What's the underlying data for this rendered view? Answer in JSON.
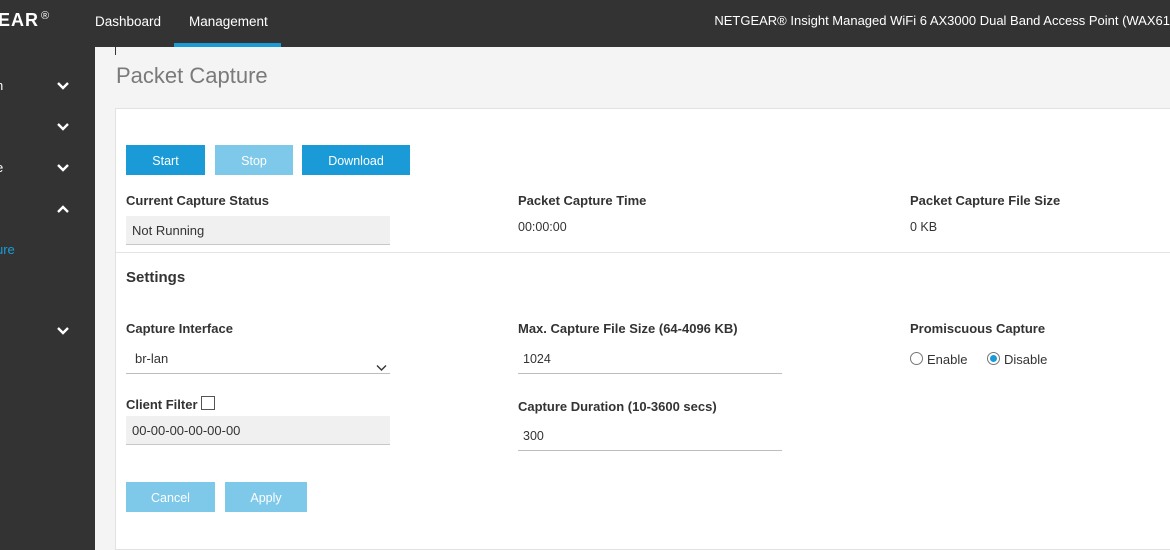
{
  "header": {
    "logo": "EAR",
    "logo_mark": "®",
    "tabs": [
      "Dashboard",
      "Management"
    ],
    "active_tab": "Management",
    "device_title": "NETGEAR® Insight Managed WiFi 6 AX3000 Dual Band Access Point (WAX61"
  },
  "sidebar": {
    "items": [
      {
        "label": "n",
        "icon": "chevron-down-icon"
      },
      {
        "label": "",
        "icon": "chevron-down-icon"
      },
      {
        "label": "e",
        "icon": "chevron-down-icon"
      },
      {
        "label": "",
        "icon": "chevron-up-icon"
      },
      {
        "label": "ure",
        "icon": ""
      },
      {
        "label": "",
        "icon": "chevron-down-icon"
      }
    ]
  },
  "page": {
    "title": "Packet Capture",
    "buttons": {
      "start": "Start",
      "stop": "Stop",
      "download": "Download"
    },
    "status": {
      "current_label": "Current Capture Status",
      "current_value": "Not Running",
      "time_label": "Packet Capture Time",
      "time_value": "00:00:00",
      "size_label": "Packet Capture File Size",
      "size_value": "0 KB"
    },
    "settings": {
      "title": "Settings",
      "interface_label": "Capture Interface",
      "interface_value": "br-lan",
      "max_size_label": "Max. Capture File Size (64-4096 KB)",
      "max_size_value": "1024",
      "promiscuous_label": "Promiscuous Capture",
      "promiscuous_options": [
        "Enable",
        "Disable"
      ],
      "promiscuous_selected": "Disable",
      "client_filter_label": "Client Filter",
      "client_filter_checked": false,
      "client_filter_value": "00-00-00-00-00-00",
      "duration_label": "Capture Duration (10-3600 secs)",
      "duration_value": "300"
    },
    "footer_buttons": {
      "cancel": "Cancel",
      "apply": "Apply"
    }
  },
  "colors": {
    "accent": "#1a9bd7",
    "accent_light": "#7ec8ea",
    "header_bg": "#333333"
  }
}
